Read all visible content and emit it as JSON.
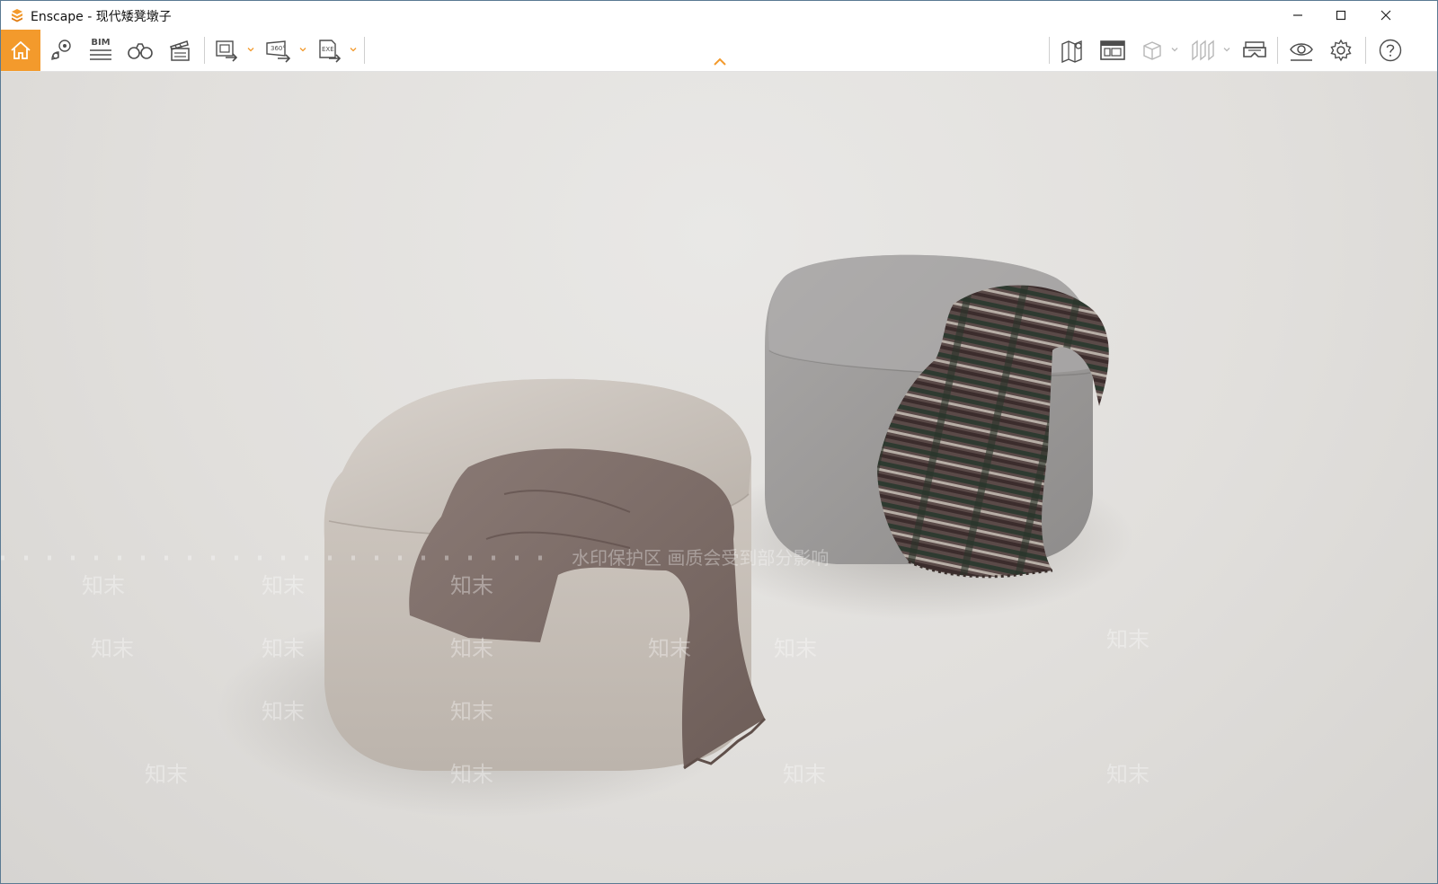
{
  "window": {
    "title": "Enscape - 现代矮凳墩子"
  },
  "titlebar_controls": {
    "minimize": "minimize-icon",
    "maximize": "maximize-icon",
    "close": "close-icon"
  },
  "toolbar": {
    "bim_label": "BIM",
    "left_tools": [
      "home-icon",
      "views-pin-icon",
      "bim-icon",
      "binoculars-icon",
      "clapper-icon",
      "export-image-icon",
      "export-360-icon",
      "export-exe-icon"
    ],
    "right_tools": [
      "map-icon",
      "asset-library-icon",
      "cube-view-icon",
      "sections-icon",
      "vr-headset-icon",
      "visual-settings-eye-icon",
      "gear-icon",
      "help-icon"
    ],
    "export_360_label": "360°",
    "export_exe_label": "EXE"
  },
  "colors": {
    "accent": "#f39a2c",
    "icon": "#4d4d4d",
    "icon_disabled": "#b7b7b7"
  },
  "watermark": {
    "notice": "水印保护区 画质会受到部分影响",
    "brand": "知末"
  }
}
